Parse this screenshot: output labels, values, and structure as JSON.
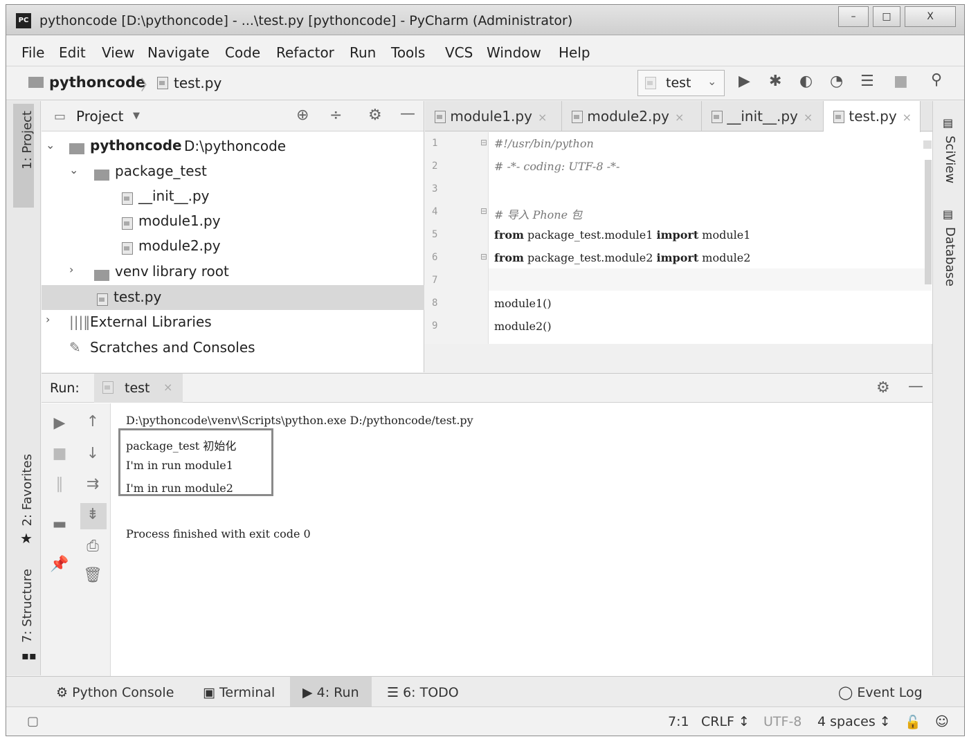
{
  "window": {
    "title": "pythoncode [D:\\pythoncode] - ...\\test.py [pythoncode] - PyCharm (Administrator)",
    "app_icon_label": "PC",
    "minimize": "–",
    "maximize": "□",
    "close": "X"
  },
  "menu": [
    "File",
    "Edit",
    "View",
    "Navigate",
    "Code",
    "Refactor",
    "Run",
    "Tools",
    "VCS",
    "Window",
    "Help"
  ],
  "breadcrumb": {
    "project": "pythoncode",
    "file": "test.py"
  },
  "run_config": {
    "name": "test"
  },
  "left_strip": {
    "project": "1: Project",
    "favorites": "2: Favorites",
    "structure": "7: Structure"
  },
  "right_strip": {
    "sciview": "SciView",
    "database": "Database"
  },
  "project_panel": {
    "title": "Project",
    "tree": [
      {
        "label": "pythoncode",
        "hint": "D:\\pythoncode"
      },
      {
        "label": "package_test"
      },
      {
        "label": "__init__.py"
      },
      {
        "label": "module1.py"
      },
      {
        "label": "module2.py"
      },
      {
        "label": "venv",
        "hint": "library root"
      },
      {
        "label": "test.py"
      },
      {
        "label": "External Libraries"
      },
      {
        "label": "Scratches and Consoles"
      }
    ]
  },
  "editor": {
    "tabs": [
      "module1.py",
      "module2.py",
      "__init__.py",
      "test.py"
    ],
    "active_tab": "test.py",
    "line_numbers": [
      "1",
      "2",
      "3",
      "4",
      "5",
      "6",
      "7",
      "8",
      "9"
    ],
    "lines": {
      "l1": "#!/usr/bin/python",
      "l2": "# -*- coding: UTF-8 -*-",
      "l4": "# 导入 Phone 包",
      "from": "from",
      "import": "import",
      "l5_mid": " package_test.module1 ",
      "l5_end": " module1",
      "l6_mid": " package_test.module2 ",
      "l6_end": " module2",
      "l8": "module1()",
      "l9": "module2()"
    }
  },
  "run_panel": {
    "label": "Run:",
    "tab": "test",
    "command": "D:\\pythoncode\\venv\\Scripts\\python.exe D:/pythoncode/test.py",
    "output": [
      "package_test 初始化",
      "I'm in run module1",
      "I'm in run module2"
    ],
    "exit": "Process finished with exit code 0"
  },
  "bottom_tabs": [
    "Python Console",
    "Terminal",
    "4: Run",
    "6: TODO"
  ],
  "event_log": "Event Log",
  "status": {
    "position": "7:1",
    "line_sep": "CRLF ↕",
    "encoding": "UTF-8",
    "indent": "4 spaces ↕"
  }
}
